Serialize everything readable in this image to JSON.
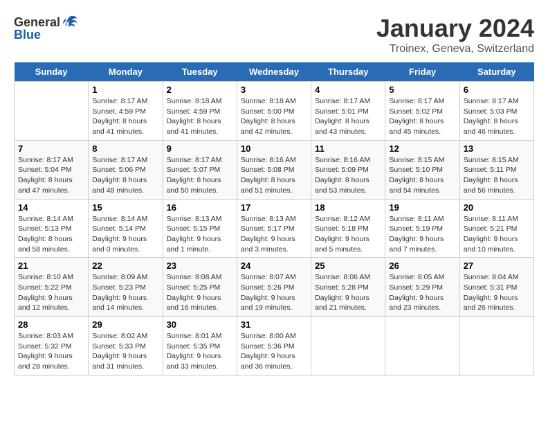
{
  "logo": {
    "text_general": "General",
    "text_blue": "Blue"
  },
  "title": "January 2024",
  "subtitle": "Troinex, Geneva, Switzerland",
  "days": [
    "Sunday",
    "Monday",
    "Tuesday",
    "Wednesday",
    "Thursday",
    "Friday",
    "Saturday"
  ],
  "weeks": [
    [
      {
        "date": "",
        "info": ""
      },
      {
        "date": "1",
        "info": "Sunrise: 8:17 AM\nSunset: 4:59 PM\nDaylight: 8 hours\nand 41 minutes."
      },
      {
        "date": "2",
        "info": "Sunrise: 8:18 AM\nSunset: 4:59 PM\nDaylight: 8 hours\nand 41 minutes."
      },
      {
        "date": "3",
        "info": "Sunrise: 8:18 AM\nSunset: 5:00 PM\nDaylight: 8 hours\nand 42 minutes."
      },
      {
        "date": "4",
        "info": "Sunrise: 8:17 AM\nSunset: 5:01 PM\nDaylight: 8 hours\nand 43 minutes."
      },
      {
        "date": "5",
        "info": "Sunrise: 8:17 AM\nSunset: 5:02 PM\nDaylight: 8 hours\nand 45 minutes."
      },
      {
        "date": "6",
        "info": "Sunrise: 8:17 AM\nSunset: 5:03 PM\nDaylight: 8 hours\nand 46 minutes."
      }
    ],
    [
      {
        "date": "7",
        "info": "Sunrise: 8:17 AM\nSunset: 5:04 PM\nDaylight: 8 hours\nand 47 minutes."
      },
      {
        "date": "8",
        "info": "Sunrise: 8:17 AM\nSunset: 5:06 PM\nDaylight: 8 hours\nand 48 minutes."
      },
      {
        "date": "9",
        "info": "Sunrise: 8:17 AM\nSunset: 5:07 PM\nDaylight: 8 hours\nand 50 minutes."
      },
      {
        "date": "10",
        "info": "Sunrise: 8:16 AM\nSunset: 5:08 PM\nDaylight: 8 hours\nand 51 minutes."
      },
      {
        "date": "11",
        "info": "Sunrise: 8:16 AM\nSunset: 5:09 PM\nDaylight: 8 hours\nand 53 minutes."
      },
      {
        "date": "12",
        "info": "Sunrise: 8:15 AM\nSunset: 5:10 PM\nDaylight: 8 hours\nand 54 minutes."
      },
      {
        "date": "13",
        "info": "Sunrise: 8:15 AM\nSunset: 5:11 PM\nDaylight: 8 hours\nand 56 minutes."
      }
    ],
    [
      {
        "date": "14",
        "info": "Sunrise: 8:14 AM\nSunset: 5:13 PM\nDaylight: 8 hours\nand 58 minutes."
      },
      {
        "date": "15",
        "info": "Sunrise: 8:14 AM\nSunset: 5:14 PM\nDaylight: 9 hours\nand 0 minutes."
      },
      {
        "date": "16",
        "info": "Sunrise: 8:13 AM\nSunset: 5:15 PM\nDaylight: 9 hours\nand 1 minute."
      },
      {
        "date": "17",
        "info": "Sunrise: 8:13 AM\nSunset: 5:17 PM\nDaylight: 9 hours\nand 3 minutes."
      },
      {
        "date": "18",
        "info": "Sunrise: 8:12 AM\nSunset: 5:18 PM\nDaylight: 9 hours\nand 5 minutes."
      },
      {
        "date": "19",
        "info": "Sunrise: 8:11 AM\nSunset: 5:19 PM\nDaylight: 9 hours\nand 7 minutes."
      },
      {
        "date": "20",
        "info": "Sunrise: 8:11 AM\nSunset: 5:21 PM\nDaylight: 9 hours\nand 10 minutes."
      }
    ],
    [
      {
        "date": "21",
        "info": "Sunrise: 8:10 AM\nSunset: 5:22 PM\nDaylight: 9 hours\nand 12 minutes."
      },
      {
        "date": "22",
        "info": "Sunrise: 8:09 AM\nSunset: 5:23 PM\nDaylight: 9 hours\nand 14 minutes."
      },
      {
        "date": "23",
        "info": "Sunrise: 8:08 AM\nSunset: 5:25 PM\nDaylight: 9 hours\nand 16 minutes."
      },
      {
        "date": "24",
        "info": "Sunrise: 8:07 AM\nSunset: 5:26 PM\nDaylight: 9 hours\nand 19 minutes."
      },
      {
        "date": "25",
        "info": "Sunrise: 8:06 AM\nSunset: 5:28 PM\nDaylight: 9 hours\nand 21 minutes."
      },
      {
        "date": "26",
        "info": "Sunrise: 8:05 AM\nSunset: 5:29 PM\nDaylight: 9 hours\nand 23 minutes."
      },
      {
        "date": "27",
        "info": "Sunrise: 8:04 AM\nSunset: 5:31 PM\nDaylight: 9 hours\nand 26 minutes."
      }
    ],
    [
      {
        "date": "28",
        "info": "Sunrise: 8:03 AM\nSunset: 5:32 PM\nDaylight: 9 hours\nand 28 minutes."
      },
      {
        "date": "29",
        "info": "Sunrise: 8:02 AM\nSunset: 5:33 PM\nDaylight: 9 hours\nand 31 minutes."
      },
      {
        "date": "30",
        "info": "Sunrise: 8:01 AM\nSunset: 5:35 PM\nDaylight: 9 hours\nand 33 minutes."
      },
      {
        "date": "31",
        "info": "Sunrise: 8:00 AM\nSunset: 5:36 PM\nDaylight: 9 hours\nand 36 minutes."
      },
      {
        "date": "",
        "info": ""
      },
      {
        "date": "",
        "info": ""
      },
      {
        "date": "",
        "info": ""
      }
    ]
  ]
}
